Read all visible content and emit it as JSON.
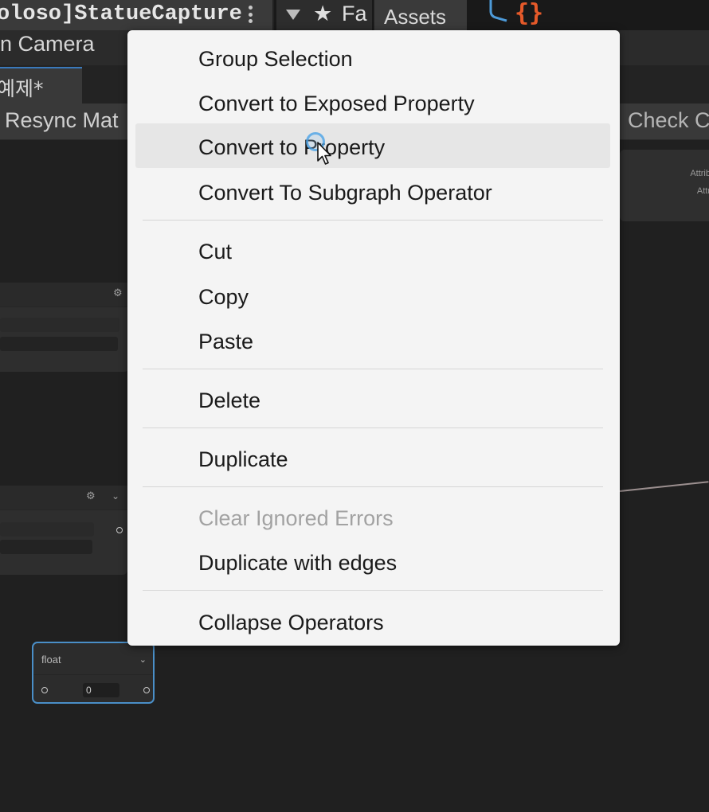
{
  "editor": {
    "window_tab_title": "oloso]StatueCapture",
    "favorites_label": "Fa",
    "assets_tab": "Assets",
    "camera_label": "n Camera",
    "document_tab": "예제*",
    "resync_button": "Resync Mat",
    "check_button": "Check C",
    "accent_color": "#3a79bb",
    "logo_color": "#e65a2a"
  },
  "graph": {
    "right_node_attrs": [
      "Attrib",
      "Attr"
    ],
    "float_node": {
      "type_label": "float",
      "value": "0"
    }
  },
  "context_menu": {
    "groups": [
      [
        "Group Selection",
        "Convert to Exposed Property",
        "Convert to Property",
        "Convert To Subgraph Operator"
      ],
      [
        "Cut",
        "Copy",
        "Paste"
      ],
      [
        "Delete"
      ],
      [
        "Duplicate"
      ],
      [
        "Clear Ignored Errors",
        "Duplicate with edges"
      ],
      [
        "Collapse Operators"
      ]
    ],
    "hovered_item": "Convert to Property",
    "disabled_item": "Clear Ignored Errors"
  }
}
